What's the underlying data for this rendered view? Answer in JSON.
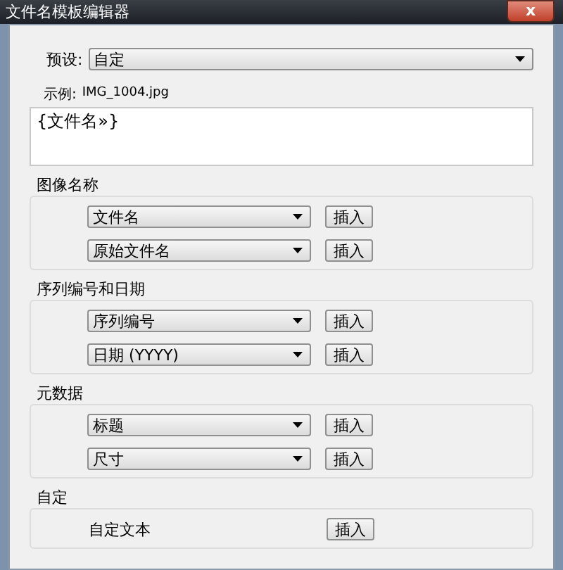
{
  "window": {
    "title": "文件名模板编辑器",
    "close": "x"
  },
  "preset": {
    "label": "预设:",
    "value": "自定"
  },
  "example": {
    "label": "示例:",
    "value": "IMG_1004.jpg"
  },
  "template": "{文件名»}",
  "groups": [
    {
      "title": "图像名称",
      "rows": [
        {
          "kind": "select",
          "value": "文件名",
          "button": "插入"
        },
        {
          "kind": "select",
          "value": "原始文件名",
          "button": "插入"
        }
      ]
    },
    {
      "title": "序列编号和日期",
      "rows": [
        {
          "kind": "select",
          "value": "序列编号",
          "button": "插入"
        },
        {
          "kind": "select",
          "value": "日期 (YYYY)",
          "button": "插入"
        }
      ]
    },
    {
      "title": "元数据",
      "rows": [
        {
          "kind": "select",
          "value": "标题",
          "button": "插入"
        },
        {
          "kind": "select",
          "value": "尺寸",
          "button": "插入"
        }
      ]
    },
    {
      "title": "自定",
      "rows": [
        {
          "kind": "text",
          "value": "自定文本",
          "button": "插入"
        }
      ]
    }
  ]
}
